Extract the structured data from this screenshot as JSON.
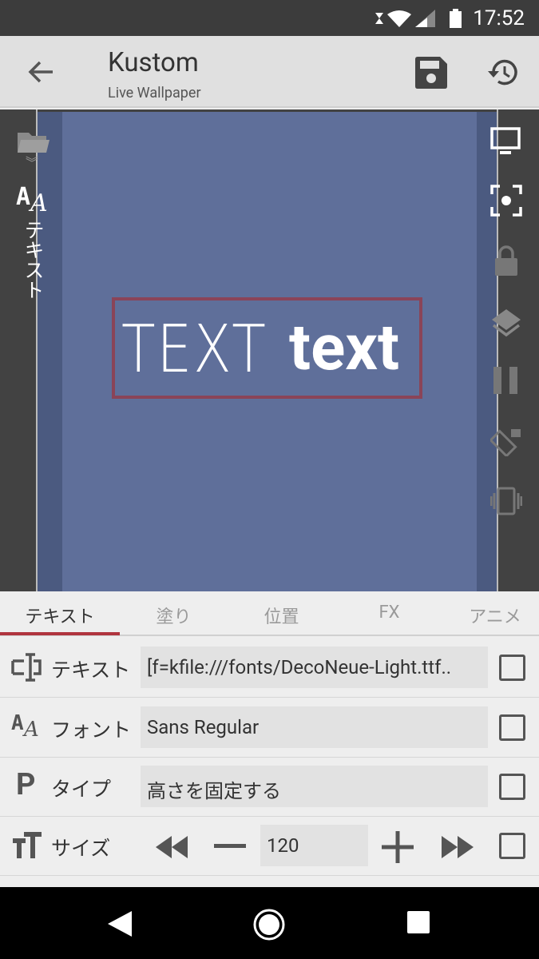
{
  "status_bar": {
    "time": "17:52"
  },
  "toolbar": {
    "title": "Kustom",
    "subtitle": "Live Wallpaper"
  },
  "preview": {
    "sidebar_label": "テキスト",
    "text_light": "TEXT",
    "text_bold": "text",
    "background_color": "#5f6f9a",
    "selection_color": "#8a4458"
  },
  "tabs": [
    {
      "label": "テキスト",
      "active": true
    },
    {
      "label": "塗り"
    },
    {
      "label": "位置"
    },
    {
      "label": "FX"
    },
    {
      "label": "アニメ"
    }
  ],
  "rows": [
    {
      "label": "テキスト",
      "value": "[f=kfile:///fonts/DecoNeue-Light.ttf.."
    },
    {
      "label": "フォント",
      "value": "Sans Regular"
    },
    {
      "label": "タイプ",
      "value": "高さを固定する"
    },
    {
      "label": "サイズ",
      "value": "120"
    }
  ],
  "accent": "#b0343e"
}
